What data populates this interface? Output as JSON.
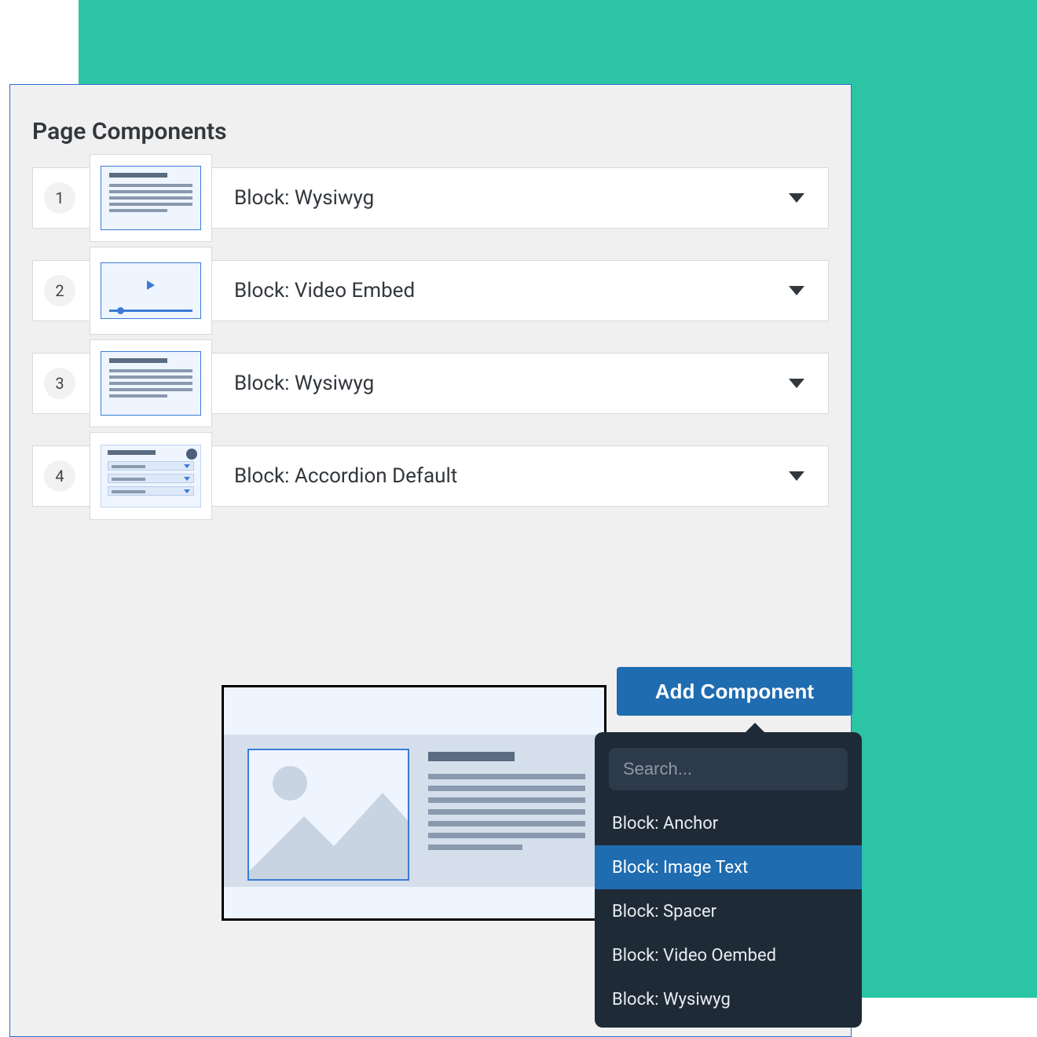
{
  "panel": {
    "title": "Page Components"
  },
  "rows": [
    {
      "number": "1",
      "label": "Block: Wysiwyg",
      "thumb": "wysiwyg"
    },
    {
      "number": "2",
      "label": "Block: Video Embed",
      "thumb": "video"
    },
    {
      "number": "3",
      "label": "Block: Wysiwyg",
      "thumb": "wysiwyg"
    },
    {
      "number": "4",
      "label": "Block: Accordion Default",
      "thumb": "accordion"
    }
  ],
  "add_button": {
    "label": "Add Component"
  },
  "dropdown": {
    "search_placeholder": "Search...",
    "options": [
      {
        "label": "Block: Anchor",
        "selected": false
      },
      {
        "label": "Block: Image Text",
        "selected": true
      },
      {
        "label": "Block: Spacer",
        "selected": false
      },
      {
        "label": "Block: Video Oembed",
        "selected": false
      },
      {
        "label": "Block: Wysiwyg",
        "selected": false
      }
    ]
  }
}
